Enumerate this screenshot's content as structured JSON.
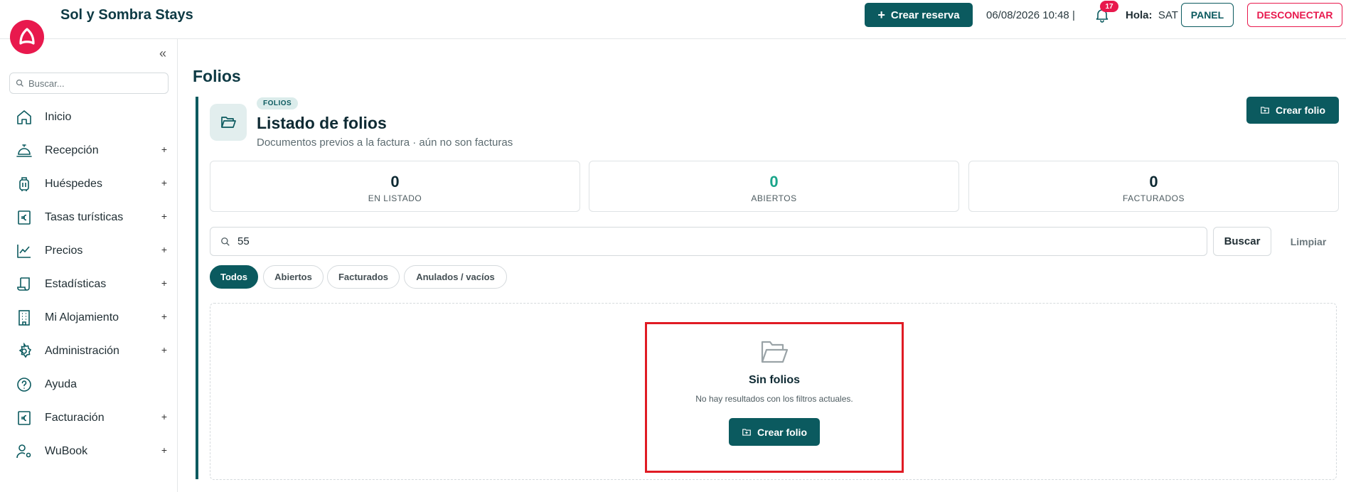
{
  "header": {
    "app_title": "Sol y Sombra Stays",
    "crear_reserva_label": "Crear reserva",
    "datetime": "06/08/2026 10:48 |",
    "notification_count": "17",
    "greeting_label": "Hola:",
    "user_name": "SAT",
    "panel_label": "PANEL",
    "disconnect_label": "DESCONECTAR"
  },
  "sidebar": {
    "search_placeholder": "Buscar...",
    "items": [
      {
        "label": "Inicio",
        "icon": "home-icon",
        "expandable": false
      },
      {
        "label": "Recepción",
        "icon": "bell-desk-icon",
        "expandable": true
      },
      {
        "label": "Huéspedes",
        "icon": "luggage-icon",
        "expandable": true
      },
      {
        "label": "Tasas turísticas",
        "icon": "euro-document-icon",
        "expandable": true
      },
      {
        "label": "Precios",
        "icon": "line-chart-icon",
        "expandable": true
      },
      {
        "label": "Estadísticas",
        "icon": "scroll-icon",
        "expandable": true
      },
      {
        "label": "Mi Alojamiento",
        "icon": "building-icon",
        "expandable": true
      },
      {
        "label": "Administración",
        "icon": "gear-icon",
        "expandable": true
      },
      {
        "label": "Ayuda",
        "icon": "help-icon",
        "expandable": false
      },
      {
        "label": "Facturación",
        "icon": "euro-document-icon",
        "expandable": true
      },
      {
        "label": "WuBook",
        "icon": "user-settings-icon",
        "expandable": true
      }
    ],
    "expand_symbol": "+"
  },
  "main": {
    "page_title": "Folios",
    "tag": "FOLIOS",
    "list_title": "Listado de folios",
    "list_subtitle": "Documentos previos a la factura · aún no son facturas",
    "crear_folio_label": "Crear folio",
    "stats": [
      {
        "value": "0",
        "label": "EN LISTADO",
        "color": "#0e2a33"
      },
      {
        "value": "0",
        "label": "ABIERTOS",
        "color": "#1aa58a"
      },
      {
        "value": "0",
        "label": "FACTURADOS",
        "color": "#0e2a33"
      }
    ],
    "search_value": "55",
    "buscar_label": "Buscar",
    "limpiar_label": "Limpiar",
    "filters": [
      {
        "label": "Todos",
        "active": true
      },
      {
        "label": "Abiertos",
        "active": false
      },
      {
        "label": "Facturados",
        "active": false
      },
      {
        "label": "Anulados / vacíos",
        "active": false
      }
    ],
    "empty": {
      "title": "Sin folios",
      "subtitle": "No hay resultados con los filtros actuales.",
      "button_label": "Crear folio"
    }
  },
  "colors": {
    "primary": "#0b5a5f",
    "accent": "#e8194d",
    "success": "#1aa58a",
    "highlight": "#e01b24"
  }
}
